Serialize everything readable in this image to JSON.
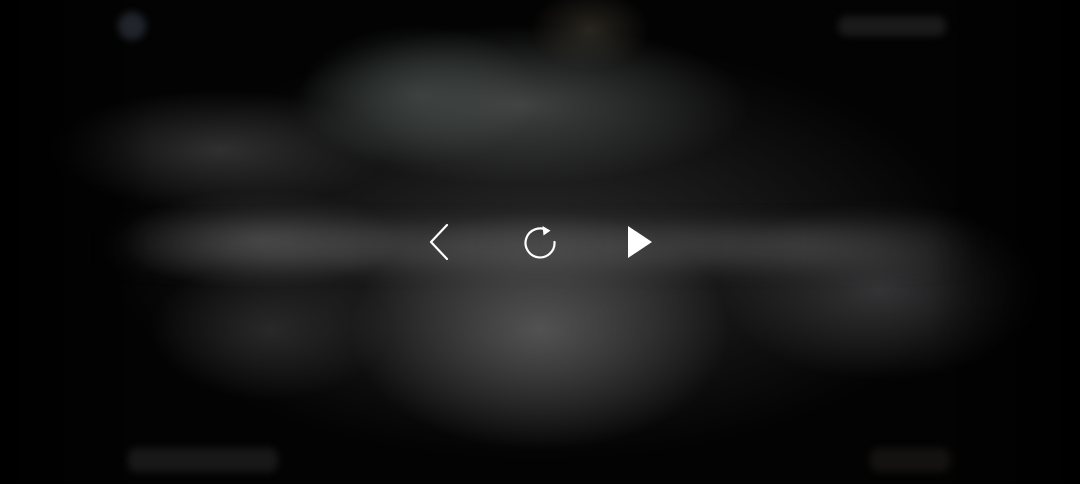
{
  "player": {
    "state": "paused",
    "controls": [
      {
        "id": "back",
        "icon": "chevron-left-icon",
        "interactable": true
      },
      {
        "id": "replay",
        "icon": "replay-icon",
        "interactable": true
      },
      {
        "id": "play",
        "icon": "play-icon",
        "interactable": true
      }
    ],
    "icon_color": "#ffffff"
  }
}
